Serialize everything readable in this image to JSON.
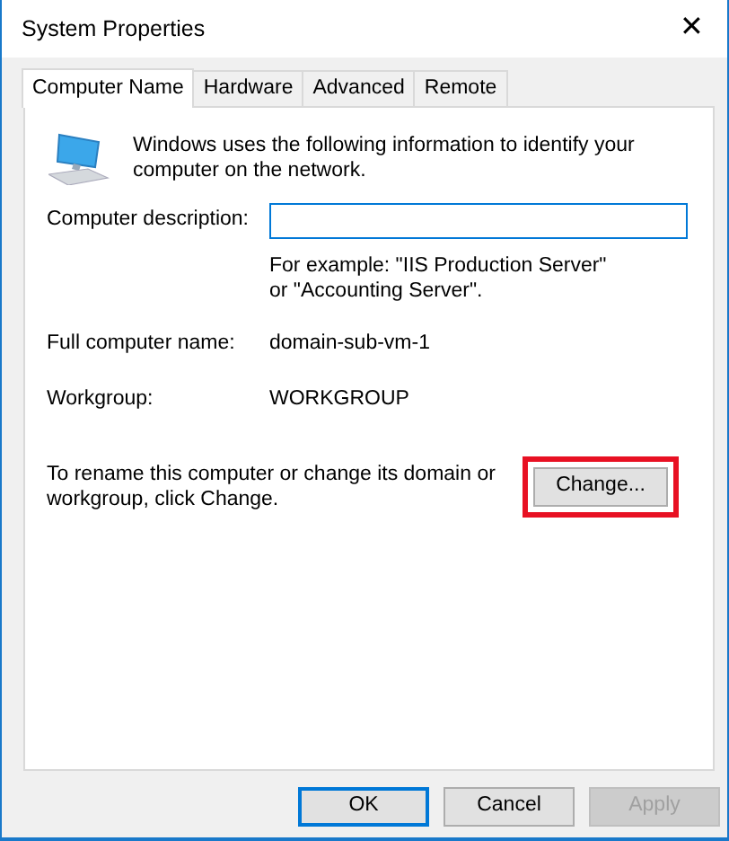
{
  "window": {
    "title": "System Properties",
    "close": "✕"
  },
  "tabs": [
    {
      "label": "Computer Name",
      "selected": true
    },
    {
      "label": "Hardware",
      "selected": false
    },
    {
      "label": "Advanced",
      "selected": false
    },
    {
      "label": "Remote",
      "selected": false
    }
  ],
  "intro": "Windows uses the following information to identify your computer on the network.",
  "description": {
    "label": "Computer description:",
    "focused": true,
    "hint": "For example: \"IIS Production Server\" or \"Accounting Server\"."
  },
  "fields": [
    {
      "label": "Full computer name:",
      "value": "domain-sub-vm-1"
    },
    {
      "label": "Workgroup:",
      "value": "WORKGROUP"
    }
  ],
  "rename": {
    "text": "To rename this computer or change its domain or workgroup, click Change.",
    "button": "Change...",
    "highlighted": true
  },
  "buttons": [
    {
      "label": "OK",
      "default": true,
      "disabled": false
    },
    {
      "label": "Cancel",
      "default": false,
      "disabled": false
    },
    {
      "label": "Apply",
      "default": false,
      "disabled": true
    }
  ]
}
